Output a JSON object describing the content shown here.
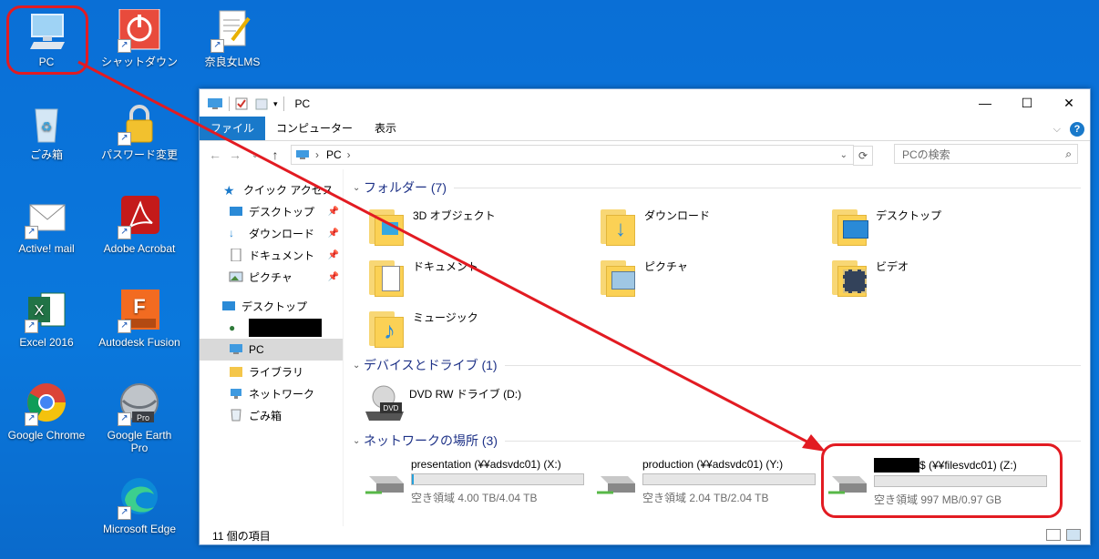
{
  "desktop": {
    "icons": [
      {
        "label": "PC",
        "icon": "pc-icon"
      },
      {
        "label": "シャットダウン",
        "icon": "power-icon"
      },
      {
        "label": "奈良女LMS",
        "icon": "document-icon"
      },
      {
        "label": "ごみ箱",
        "icon": "recycle-bin-icon"
      },
      {
        "label": "パスワード変更",
        "icon": "lock-icon"
      },
      {
        "label": "Active! mail",
        "icon": "mail-icon"
      },
      {
        "label": "Adobe Acrobat",
        "icon": "acrobat-icon"
      },
      {
        "label": "Excel 2016",
        "icon": "excel-icon"
      },
      {
        "label": "Autodesk Fusion",
        "icon": "fusion-icon"
      },
      {
        "label": "Google Chrome",
        "icon": "chrome-icon"
      },
      {
        "label": "Google Earth Pro",
        "icon": "earth-icon"
      },
      {
        "label": "Microsoft Edge",
        "icon": "edge-icon"
      }
    ]
  },
  "window": {
    "title": "PC",
    "ribbon_tabs": [
      "ファイル",
      "コンピューター",
      "表示"
    ],
    "address": {
      "location": "PC",
      "separator": "›"
    },
    "search_placeholder": "PCの検索",
    "nav": {
      "quick_access": "クイック アクセス",
      "quick_items": [
        "デスクトップ",
        "ダウンロード",
        "ドキュメント",
        "ピクチャ"
      ],
      "desktop": "デスクトップ",
      "pc": "PC",
      "library": "ライブラリ",
      "network": "ネットワーク",
      "recycle": "ごみ箱"
    },
    "groups": {
      "folders": "フォルダー (7)",
      "devices": "デバイスとドライブ (1)",
      "network": "ネットワークの場所 (3)"
    },
    "folders": [
      "3D オブジェクト",
      "ダウンロード",
      "デスクトップ",
      "ドキュメント",
      "ピクチャ",
      "ビデオ",
      "ミュージック"
    ],
    "dvd": "DVD RW ドライブ (D:)",
    "dvd_badge": "DVD",
    "drives": [
      {
        "name": "presentation (¥¥adsvdc01) (X:)",
        "free": "空き領域 4.00 TB/4.04 TB",
        "used_fraction": 0.01
      },
      {
        "name": "production (¥¥adsvdc01) (Y:)",
        "free": "空き領域 2.04 TB/2.04 TB",
        "used_fraction": 0.0
      },
      {
        "name": "$ (¥¥filesvdc01) (Z:)",
        "free": "空き領域 997 MB/0.97 GB",
        "used_fraction": 0.0
      }
    ],
    "status": "11 個の項目"
  },
  "colors": {
    "accent": "#1979ca",
    "annotation": "#e21b22",
    "desktop_bg": "#0a78dd"
  }
}
